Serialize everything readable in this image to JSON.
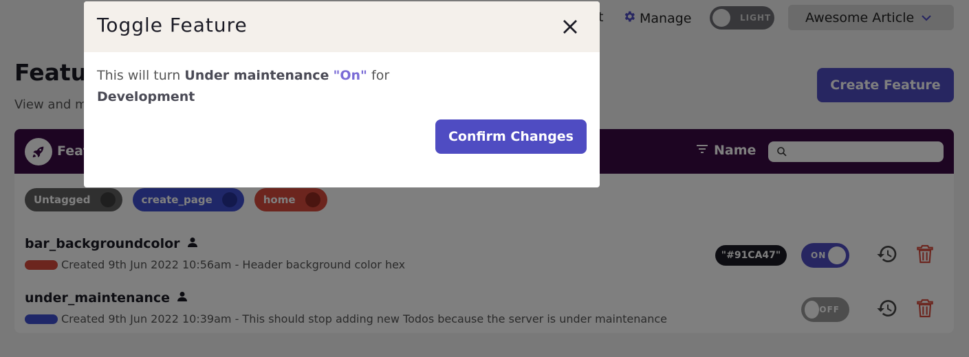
{
  "nav": {
    "partial_link": "nt",
    "manage_label": "Manage",
    "theme_label": "LIGHT",
    "project_name": "Awesome Article"
  },
  "page": {
    "title": "Features",
    "subtitle": "View and manage your feature flags",
    "create_label": "Create Feature"
  },
  "panel": {
    "header_title": "Features",
    "sort_label": "Name",
    "search_value": ""
  },
  "tags": [
    {
      "label": "Untagged",
      "color": "#606060"
    },
    {
      "label": "create_page",
      "color": "#3f4fd1"
    },
    {
      "label": "home",
      "color": "#d84a3c"
    }
  ],
  "features": [
    {
      "name": "bar_backgroundcolor",
      "meta": "Created 9th Jun 2022 10:56am - Header background color hex",
      "tag_color": "#d84a3c",
      "value": "\"#91CA47\"",
      "switch_label": "ON",
      "enabled": true
    },
    {
      "name": "under_maintenance",
      "meta": "Created 9th Jun 2022 10:39am - This should stop adding new Todos because the server is under maintenance",
      "tag_color": "#3f4fd1",
      "value": "",
      "switch_label": "OFF",
      "enabled": false
    }
  ],
  "modal": {
    "title": "Toggle Feature",
    "text_prefix": "This will turn",
    "feature_name": "Under maintenance",
    "state_word": "\"On\"",
    "text_for": "for",
    "environment": "Development",
    "confirm_label": "Confirm Changes"
  },
  "colors": {
    "accent": "#4f4cc2",
    "header_bg": "#3b0b44",
    "modal_header_bg": "#f4f0eb",
    "danger": "#d84a3c"
  }
}
